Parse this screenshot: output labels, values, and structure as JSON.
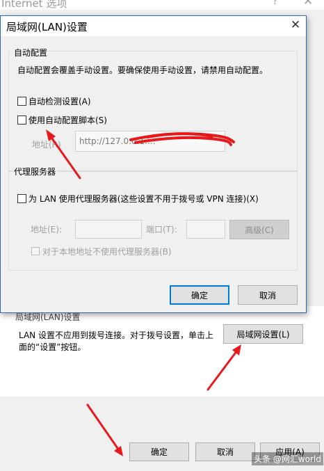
{
  "background_window": {
    "title": "Internet 选项",
    "help_glyph": "?",
    "close_glyph": "✕",
    "section_title": "局域网(LAN)设置",
    "description": "LAN 设置不应用到拨号连接。对于拨号设置，单击上面的“设置”按钮。",
    "lan_settings_button": "局域网设置(L)",
    "buttons": {
      "ok": "确定",
      "cancel": "取消",
      "apply": "应用(A)"
    }
  },
  "watermark": "头条 @网汇world",
  "dialog": {
    "title": "局域网(LAN)设置",
    "close_glyph": "✕",
    "auto_config": {
      "group_label": "自动配置",
      "description": "自动配置会覆盖手动设置。要确保使用手动设置，请禁用自动配置。",
      "autodetect_label": "自动检测设置(A)",
      "autodetect_checked": false,
      "use_script_label": "使用自动配置脚本(S)",
      "use_script_checked": false,
      "address_label": "地址(R)",
      "address_value": "http://127.0.0.1:..."
    },
    "proxy": {
      "group_label": "代理服务器",
      "use_proxy_label": "为 LAN 使用代理服务器(这些设置不用于拨号或 VPN 连接)(X)",
      "use_proxy_checked": false,
      "address_label": "地址(E):",
      "port_label": "端口(T):",
      "advanced_button": "高级(C)",
      "bypass_label": "对于本地地址不使用代理服务器(B)",
      "bypass_checked": false
    },
    "buttons": {
      "ok": "确定",
      "cancel": "取消"
    }
  },
  "colors": {
    "annotation_red": "#e8191b",
    "dialog_border": "#2b6cb0",
    "default_button_border": "#0078d7"
  }
}
